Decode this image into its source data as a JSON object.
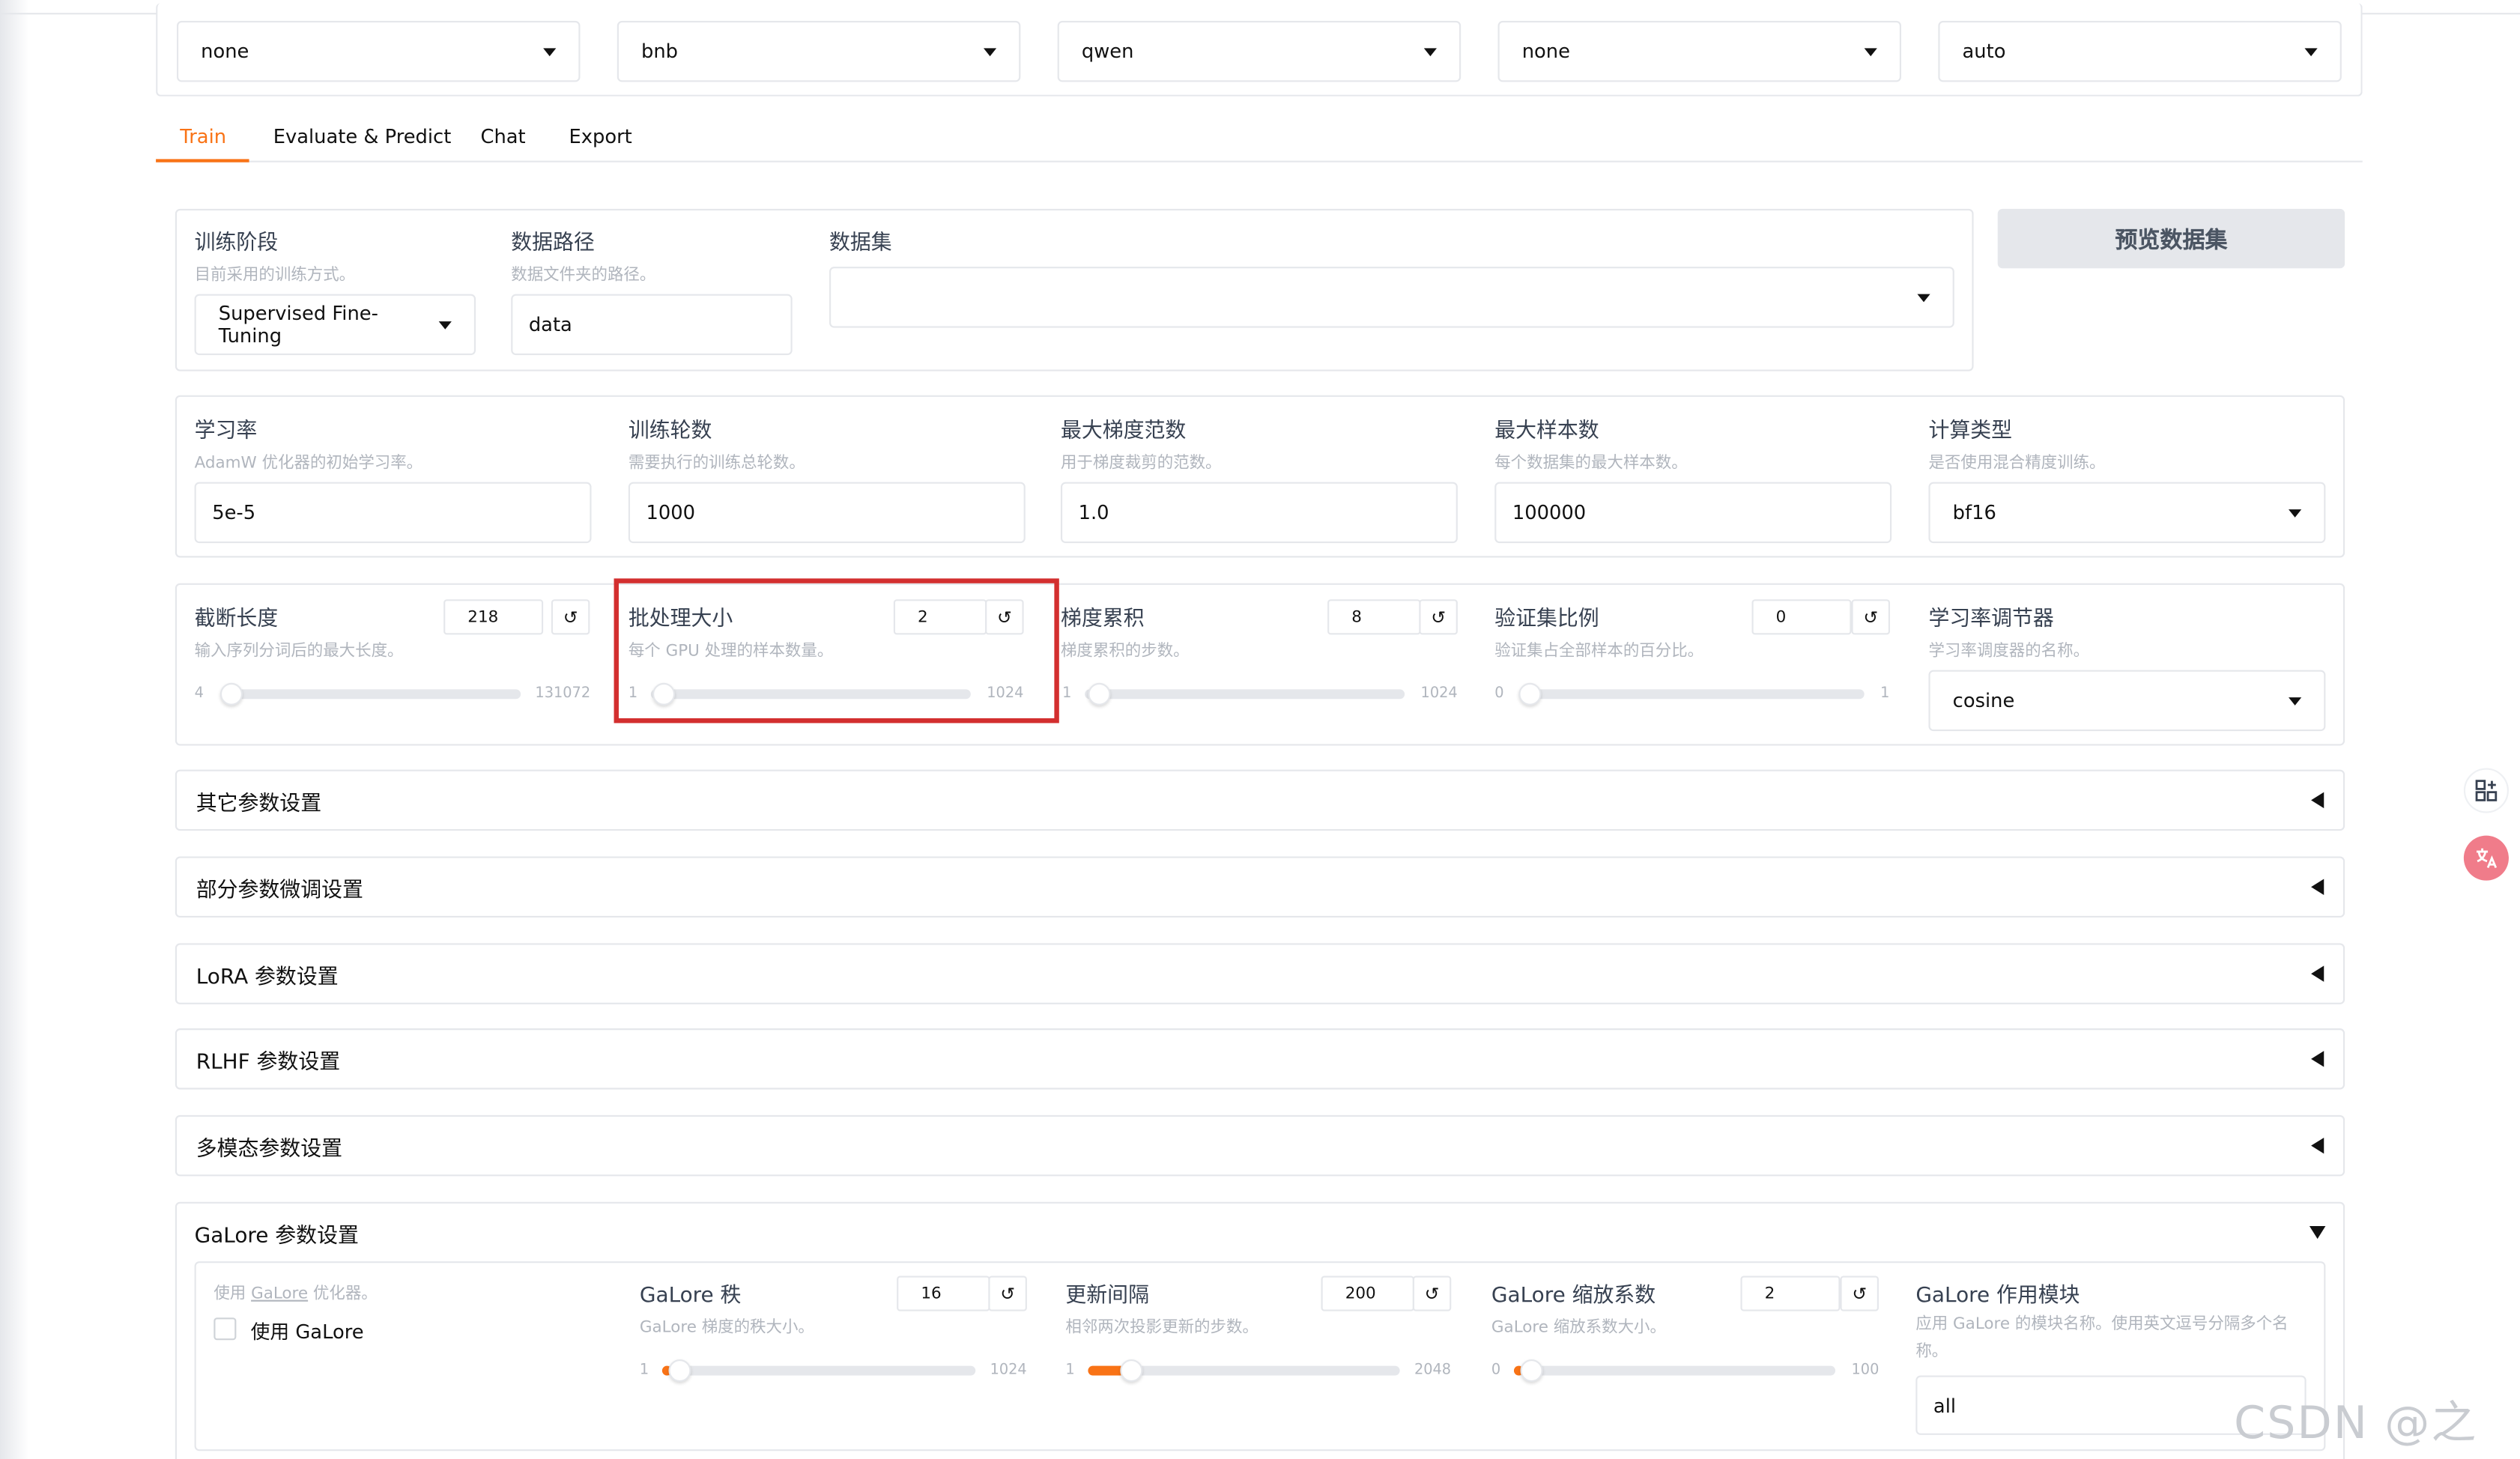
{
  "top_selects": [
    "none",
    "bnb",
    "qwen",
    "none",
    "auto"
  ],
  "tabs": [
    "Train",
    "Evaluate & Predict",
    "Chat",
    "Export"
  ],
  "stage": {
    "label": "训练阶段",
    "hint": "目前采用的训练方式。",
    "value": "Supervised Fine-Tuning"
  },
  "data_dir": {
    "label": "数据路径",
    "hint": "数据文件夹的路径。",
    "value": "data"
  },
  "dataset": {
    "label": "数据集",
    "value": ""
  },
  "preview_button": "预览数据集",
  "lr": {
    "label": "学习率",
    "hint": "AdamW 优化器的初始学习率。",
    "value": "5e-5"
  },
  "epochs": {
    "label": "训练轮数",
    "hint": "需要执行的训练总轮数。",
    "value": "1000"
  },
  "max_grad_norm": {
    "label": "最大梯度范数",
    "hint": "用于梯度裁剪的范数。",
    "value": "1.0"
  },
  "max_samples": {
    "label": "最大样本数",
    "hint": "每个数据集的最大样本数。",
    "value": "100000"
  },
  "compute_type": {
    "label": "计算类型",
    "hint": "是否使用混合精度训练。",
    "value": "bf16"
  },
  "cutoff": {
    "label": "截断长度",
    "hint": "输入序列分词后的最大长度。",
    "value": "218",
    "min": "4",
    "max": "131072",
    "fraction": 0.0017
  },
  "batch": {
    "label": "批处理大小",
    "hint": "每个 GPU 处理的样本数量。",
    "value": "2",
    "min": "1",
    "max": "1024",
    "fraction": 0.001
  },
  "grad_accum": {
    "label": "梯度累积",
    "hint": "梯度累积的步数。",
    "value": "8",
    "min": "1",
    "max": "1024",
    "fraction": 0.007
  },
  "val_size": {
    "label": "验证集比例",
    "hint": "验证集占全部样本的百分比。",
    "value": "0",
    "min": "0",
    "max": "1",
    "fraction": 0
  },
  "lr_scheduler": {
    "label": "学习率调节器",
    "hint": "学习率调度器的名称。",
    "value": "cosine"
  },
  "accordions": [
    "其它参数设置",
    "部分参数微调设置",
    "LoRA 参数设置",
    "RLHF 参数设置",
    "多模态参数设置"
  ],
  "galore": {
    "title": "GaLore 参数设置",
    "use_hint_prefix": "使用 ",
    "use_hint_link": "GaLore",
    "use_hint_suffix": " 优化器。",
    "use_label": "使用 GaLore",
    "rank": {
      "label": "GaLore 秩",
      "hint": "GaLore 梯度的秩大小。",
      "value": "16",
      "min": "1",
      "max": "1024",
      "fraction": 0.015
    },
    "interval": {
      "label": "更新间隔",
      "hint": "相邻两次投影更新的步数。",
      "value": "200",
      "min": "1",
      "max": "2048",
      "fraction": 0.097
    },
    "scale": {
      "label": "GaLore 缩放系数",
      "hint": "GaLore 缩放系数大小。",
      "value": "2",
      "min": "0",
      "max": "100",
      "fraction": 0.02
    },
    "target": {
      "label": "GaLore 作用模块",
      "hint": "应用 GaLore 的模块名称。使用英文逗号分隔多个名称。",
      "value": "all"
    }
  },
  "watermark": "CSDN @之歆",
  "colors": {
    "accent": "#f97316",
    "highlight": "#d32f2f"
  }
}
